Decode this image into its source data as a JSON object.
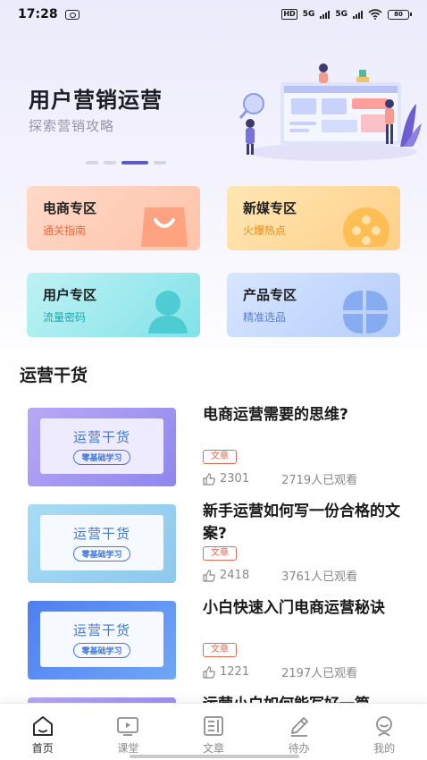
{
  "status_bar": {
    "time": "17:28",
    "hd_label": "HD",
    "network_1": "5G",
    "network_2": "5G",
    "battery": "80"
  },
  "banner": {
    "title": "用户营销运营",
    "subtitle": "探索营销攻略",
    "page_count": 4,
    "active_page": 3
  },
  "categories": [
    {
      "title": "电商专区",
      "subtitle": "通关指南",
      "icon": "shopping-bag-icon"
    },
    {
      "title": "新媒专区",
      "subtitle": "火爆热点",
      "icon": "film-reel-icon"
    },
    {
      "title": "用户专区",
      "subtitle": "流量密码",
      "icon": "user-icon"
    },
    {
      "title": "产品专区",
      "subtitle": "精准选品",
      "icon": "clover-icon"
    }
  ],
  "section": {
    "title": "运营干货"
  },
  "articles": [
    {
      "thumb_title": "运营干货",
      "thumb_badge": "零基础学习",
      "title": "电商运营需要的思维?",
      "tag": "文章",
      "likes": "2301",
      "views": "2719人已观看"
    },
    {
      "thumb_title": "运营干货",
      "thumb_badge": "零基础学习",
      "title": "新手运营如何写一份合格的文案?",
      "tag": "文章",
      "likes": "2418",
      "views": "3761人已观看"
    },
    {
      "thumb_title": "运营干货",
      "thumb_badge": "零基础学习",
      "title": "小白快速入门电商运营秘诀",
      "tag": "文章",
      "likes": "1221",
      "views": "2197人已观看"
    },
    {
      "thumb_title": "",
      "thumb_badge": "",
      "title": "运营小白如何能写好一篇",
      "tag": "",
      "likes": "",
      "views": ""
    }
  ],
  "nav": [
    {
      "label": "首页",
      "icon": "home-icon",
      "active": true
    },
    {
      "label": "课堂",
      "icon": "video-icon",
      "active": false
    },
    {
      "label": "文章",
      "icon": "article-icon",
      "active": false
    },
    {
      "label": "待办",
      "icon": "pen-icon",
      "active": false
    },
    {
      "label": "我的",
      "icon": "profile-icon",
      "active": false
    }
  ],
  "colors": {
    "accent": "#5b5bd0",
    "tag": "#e26a55",
    "thumb_text": "#3f78d6"
  }
}
